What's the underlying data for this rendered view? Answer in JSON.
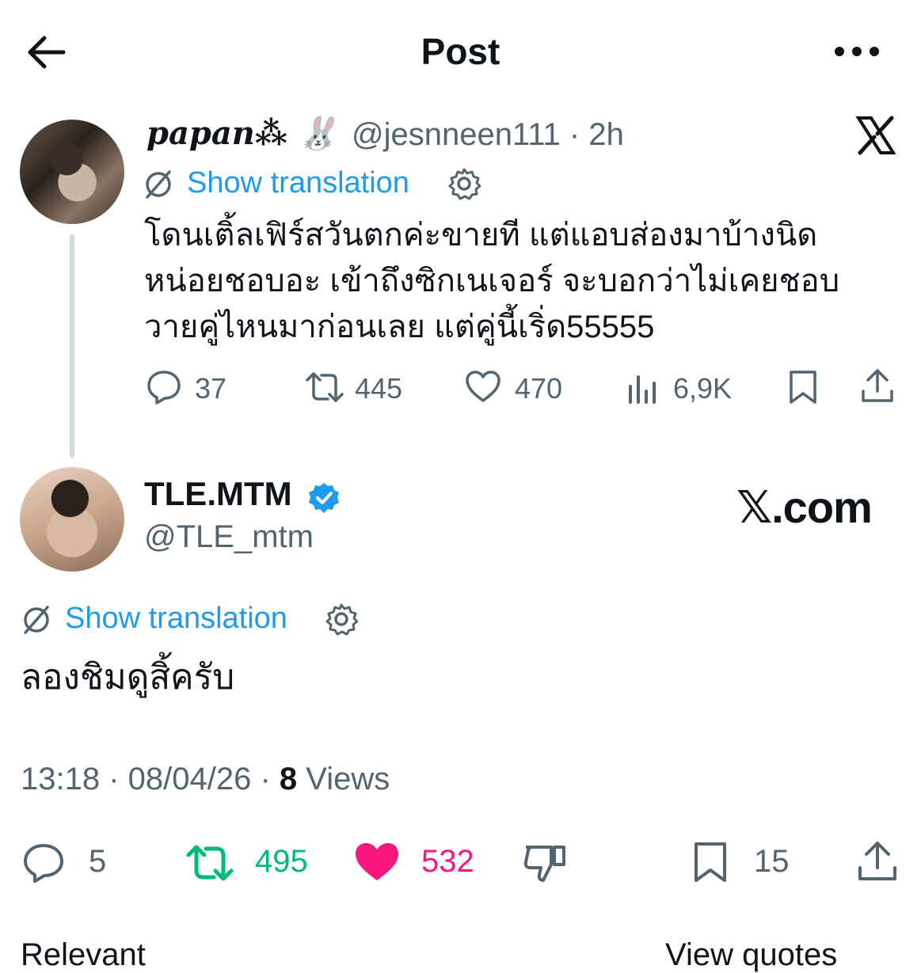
{
  "header": {
    "title": "Post",
    "back_icon": "arrow-left-icon",
    "more_icon": "more-horizontal-icon"
  },
  "quoted_post": {
    "display_name": "papan⁂ 🐰",
    "handle_time": "@jesnneen111 · 2h",
    "show_translation": "Show translation",
    "text": "โดนเติ้ลเฟิร์สวันตกค่ะขายที แต่แอบส่องมาบ้างนิดหน่อยชอบอะ เข้าถึงซิกเนเจอร์ จะบอกว่าไม่เคยชอบวายคู่ไหนมาก่อนเลย แต่คู่นี้เริ่ด55555",
    "stats": {
      "replies": "37",
      "reposts": "445",
      "likes": "470",
      "views": "6,9K"
    }
  },
  "main_post": {
    "display_name": "TLE.MTM",
    "handle": "@TLE_mtm",
    "watermark": "𝕏.com",
    "show_translation": "Show translation",
    "text": "ลองชิมดูสิ้ครับ",
    "timestamp": "13:18 · 08/04/26 · ",
    "views_count": "8",
    "views_label": " Views",
    "stats": {
      "replies": "5",
      "reposts": "495",
      "likes": "532",
      "bookmarks": "15"
    }
  },
  "colors": {
    "accent": "#1d9bf0",
    "repost_active": "#00ba7c",
    "like_active": "#f91880",
    "muted": "#536471"
  },
  "below": {
    "left_partial": "Relevant",
    "right_partial": "View quotes"
  }
}
